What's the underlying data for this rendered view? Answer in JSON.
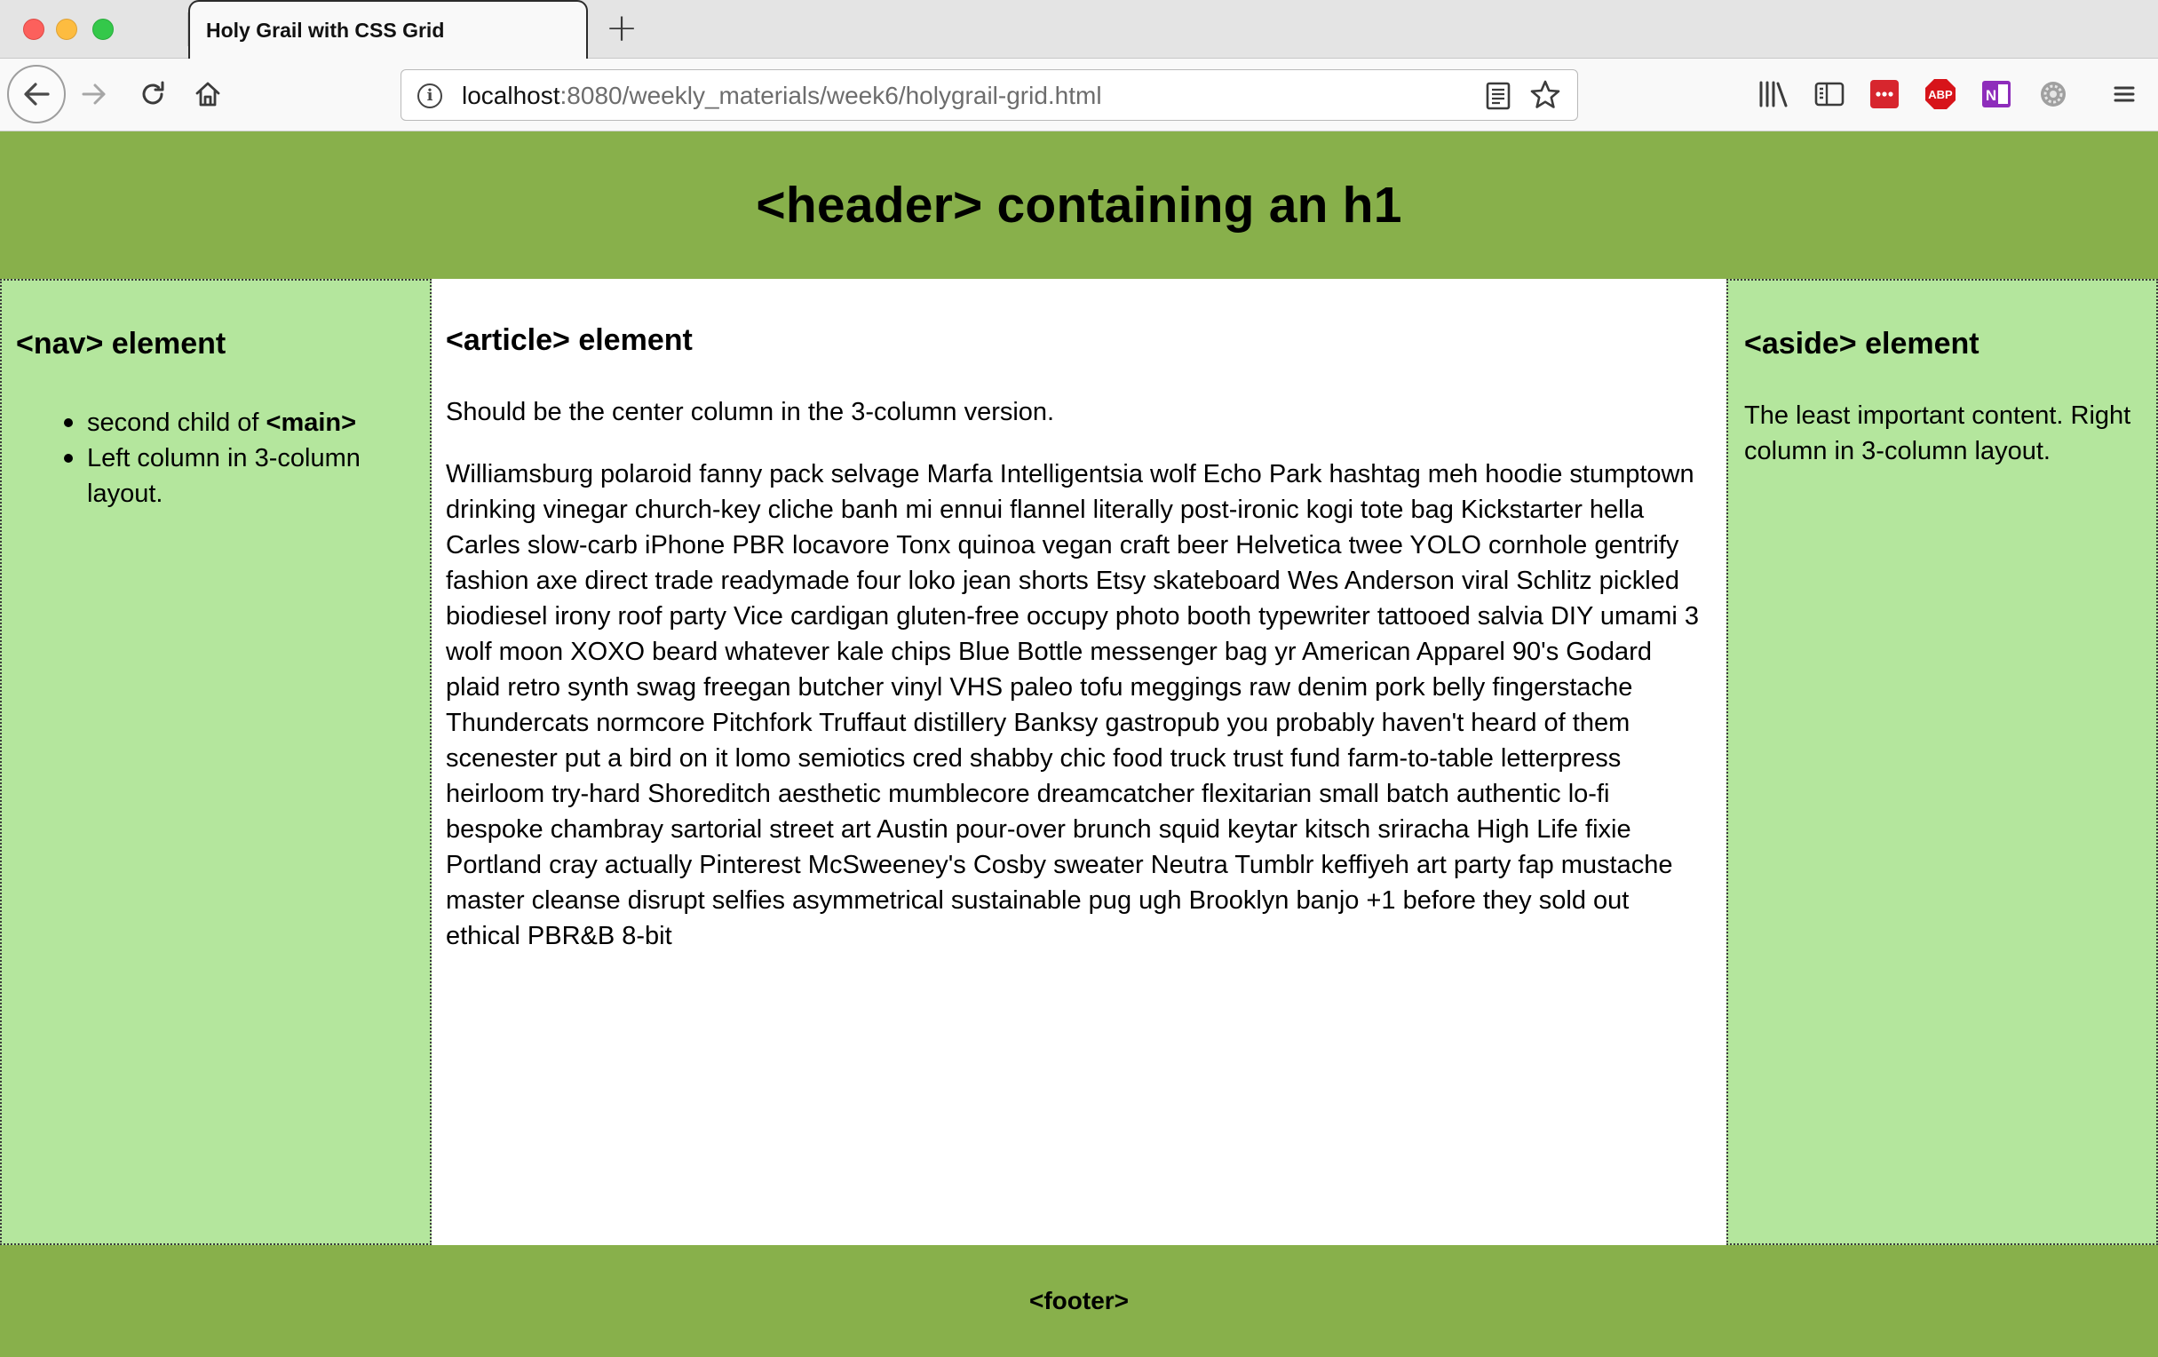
{
  "browser": {
    "tab_title": "Holy Grail with CSS Grid",
    "new_tab_glyph": "+",
    "url_host": "localhost",
    "url_rest": ":8080/weekly_materials/week6/holygrail-grid.html",
    "info_glyph": "i",
    "toolbar_icons": [
      "library-icon",
      "sidebar-icon",
      "pocket-icon",
      "adblock-icon",
      "onenote-icon",
      "settings-gear-icon",
      "menu-icon"
    ],
    "adblock_label": "ABP",
    "onenote_label": "N"
  },
  "page": {
    "header_title": "<header> containing an h1",
    "nav": {
      "title": "<nav> element",
      "items": [
        {
          "text": "second child of ",
          "bold": "<main>"
        },
        {
          "text": "Left column in 3-column layout."
        }
      ]
    },
    "article": {
      "title": "<article> element",
      "intro": "Should be the center column in the 3-column version.",
      "body": "Williamsburg polaroid fanny pack selvage Marfa Intelligentsia wolf Echo Park hashtag meh hoodie stumptown drinking vinegar church-key cliche banh mi ennui flannel literally post-ironic kogi tote bag Kickstarter hella Carles slow-carb iPhone PBR locavore Tonx quinoa vegan craft beer Helvetica twee YOLO cornhole gentrify fashion axe direct trade readymade four loko jean shorts Etsy skateboard Wes Anderson viral Schlitz pickled biodiesel irony roof party Vice cardigan gluten-free occupy photo booth typewriter tattooed salvia DIY umami 3 wolf moon XOXO beard whatever kale chips Blue Bottle messenger bag yr American Apparel 90's Godard plaid retro synth swag freegan butcher vinyl VHS paleo tofu meggings raw denim pork belly fingerstache Thundercats normcore Pitchfork Truffaut distillery Banksy gastropub you probably haven't heard of them scenester put a bird on it lomo semiotics cred shabby chic food truck trust fund farm-to-table letterpress heirloom try-hard Shoreditch aesthetic mumblecore dreamcatcher flexitarian small batch authentic lo-fi bespoke chambray sartorial street art Austin pour-over brunch squid keytar kitsch sriracha High Life fixie Portland cray actually Pinterest McSweeney's Cosby sweater Neutra Tumblr keffiyeh art party fap mustache master cleanse disrupt selfies asymmetrical sustainable pug ugh Brooklyn banjo +1 before they sold out ethical PBR&B 8-bit"
    },
    "aside": {
      "title": "<aside> element",
      "text": "The least important content. Right column in 3-column layout."
    },
    "footer": "<footer>"
  },
  "colors": {
    "header_footer_bg": "#88b04b",
    "sidebar_bg": "#b4e69d",
    "article_bg": "#ffffff"
  }
}
